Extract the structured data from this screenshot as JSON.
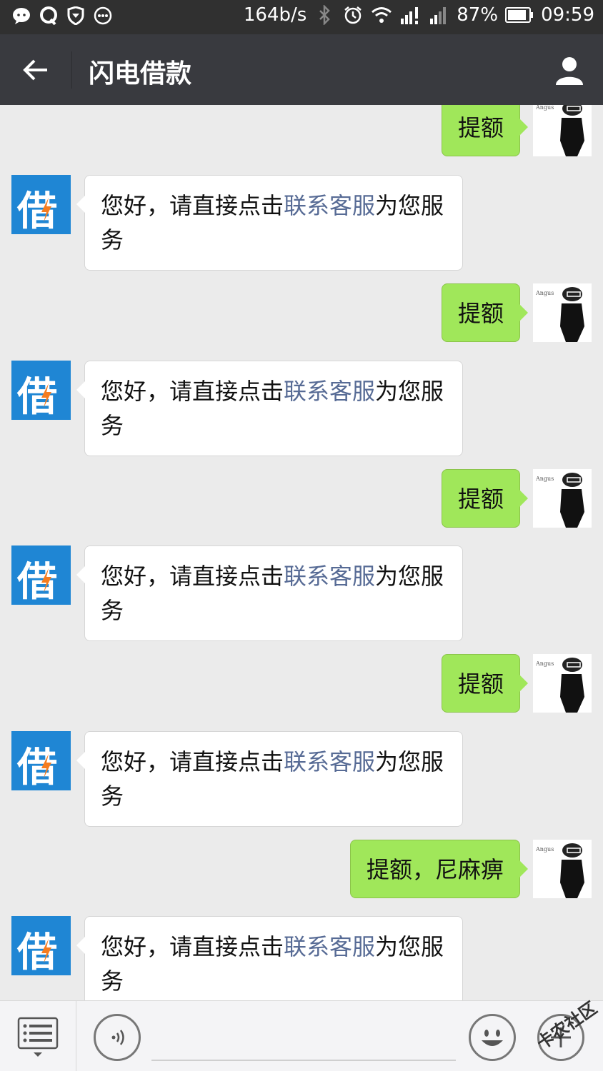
{
  "status_bar": {
    "speed": "164b/s",
    "battery": "87%",
    "time": "09:59",
    "left_icons": [
      "wechat-icon",
      "qq-icon",
      "shield-icon",
      "more-icon"
    ],
    "right_icons": [
      "bluetooth-icon",
      "alarm-icon",
      "wifi-icon",
      "signal-icon",
      "signal-icon-2",
      "battery-icon"
    ]
  },
  "header": {
    "title": "闪电借款",
    "back_icon": "arrow-left-icon",
    "user_icon": "person-icon"
  },
  "chat": {
    "bot_avatar_glyph": "借",
    "outgoing": [
      {
        "text": "提额"
      },
      {
        "text": "提额"
      },
      {
        "text": "提额"
      },
      {
        "text": "提额"
      },
      {
        "text": "提额，尼麻痹"
      }
    ],
    "incoming": [
      {
        "prefix": "您好，请直接点击",
        "link": "联系客服",
        "suffix": "为您服务"
      },
      {
        "prefix": "您好，请直接点击",
        "link": "联系客服",
        "suffix": "为您服务"
      },
      {
        "prefix": "您好，请直接点击",
        "link": "联系客服",
        "suffix": "为您服务"
      },
      {
        "prefix": "您好，请直接点击",
        "link": "联系客服",
        "suffix": "为您服务"
      },
      {
        "prefix": "您好，请直接点击",
        "link": "联系客服",
        "suffix": "为您服务"
      }
    ]
  },
  "toolbar": {
    "icons": [
      "menu-icon",
      "voice-icon",
      "emoji-icon",
      "plus-icon"
    ],
    "watermark": "卡农社区"
  },
  "colors": {
    "status_bg": "#303030",
    "titlebar_bg": "#393a3f",
    "chat_bg": "#ebebeb",
    "out_bubble": "#a0e75a",
    "link": "#576b95",
    "bot_avatar": "#1f86d4"
  }
}
